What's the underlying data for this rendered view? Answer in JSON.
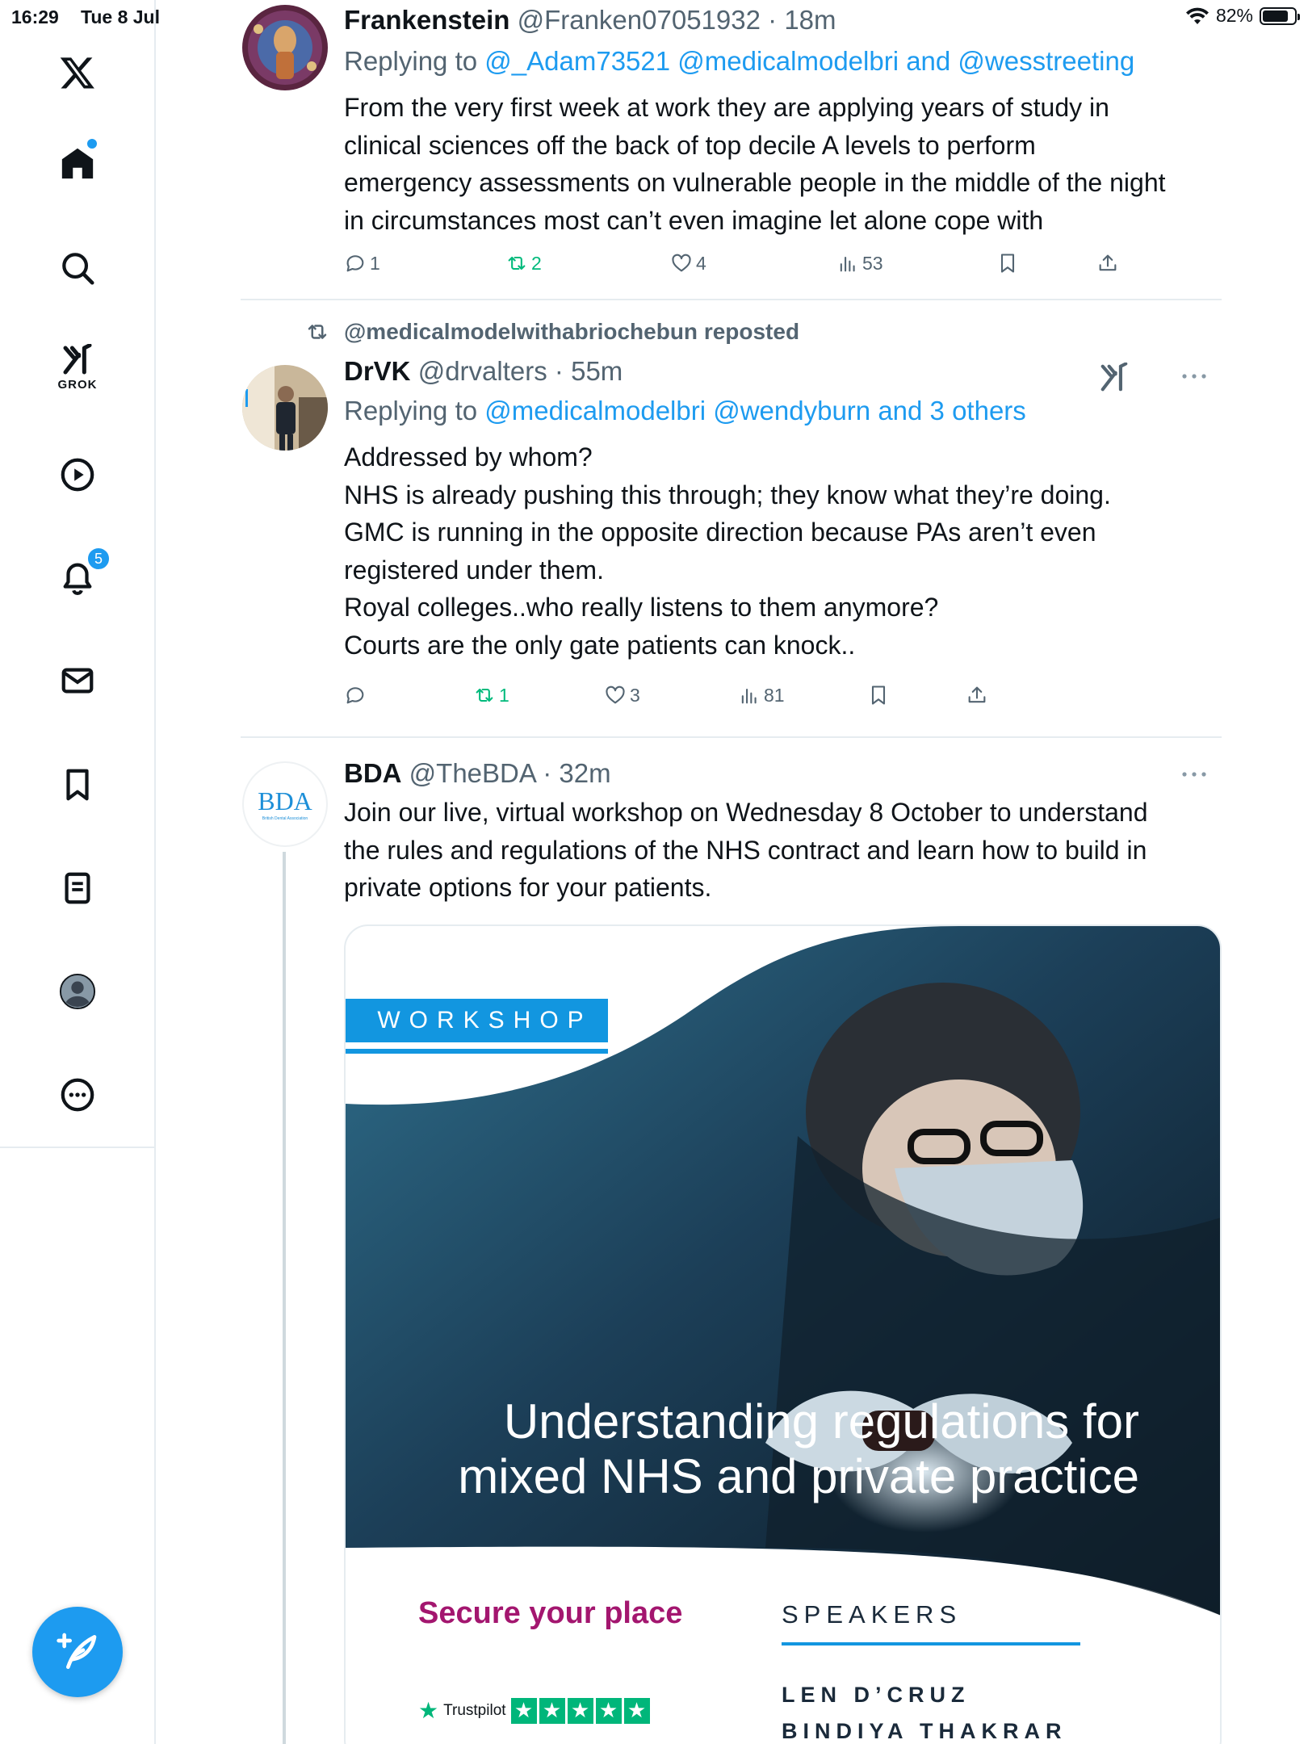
{
  "status_bar": {
    "time": "16:29",
    "date": "Tue 8 Jul",
    "battery": "82%",
    "battery_level": 0.82
  },
  "sidebar": {
    "grok_label": "GROK",
    "notifications_count": "5"
  },
  "tweets": [
    {
      "name": "Frankenstein",
      "handle": "@Franken07051932",
      "time": "18m",
      "reply_prefix": "Replying to",
      "reply_to": "@_Adam73521 @medicalmodelbri and @wesstreeting",
      "text_lines": [
        "From the very first week at work they are applying years of study in",
        "clinical sciences off the back of top decile A levels to perform",
        "emergency assessments on vulnerable people in the middle of the night",
        "in circumstances most can’t even imagine let alone cope with"
      ],
      "replies": "1",
      "reposts": "2",
      "likes": "4",
      "views": "53"
    },
    {
      "repost_label": "@medicalmodelwithabriochebun reposted",
      "name": "DrVK",
      "handle": "@drvalters",
      "time": "55m",
      "reply_prefix": "Replying to",
      "reply_to": "@medicalmodelbri @wendyburn and 3 others",
      "text_lines": [
        "Addressed by whom?",
        "NHS is already pushing this through; they know what they’re doing.",
        "GMC is running in the opposite direction because PAs aren’t even",
        "registered under them.",
        "Royal colleges..who really listens to them anymore?",
        "Courts are the only gate patients can knock.."
      ],
      "replies": "",
      "reposts": "1",
      "likes": "3",
      "views": "81"
    },
    {
      "name": "BDA",
      "handle": "@TheBDA",
      "time": "32m",
      "avatar_text": "BDA",
      "avatar_subtext": "British Dental Association",
      "text_lines": [
        "Join our live, virtual workshop on Wednesday 8 October to understand",
        "the rules and regulations of the NHS contract and learn how to build in",
        "private options for your patients."
      ],
      "media": {
        "tag": "WORKSHOP",
        "headline_lines": [
          "Understanding regulations for",
          "mixed NHS and private practice"
        ],
        "cta": "Secure your place",
        "speakers_title": "SPEAKERS",
        "speakers": [
          "LEN D’CRUZ",
          "BINDIYA THAKRAR"
        ],
        "trustpilot": "Trustpilot"
      }
    }
  ],
  "colors": {
    "accent": "#1d9bf0",
    "repost_green": "#00ba7c",
    "muted": "#536471",
    "cta_magenta": "#a3166f"
  }
}
